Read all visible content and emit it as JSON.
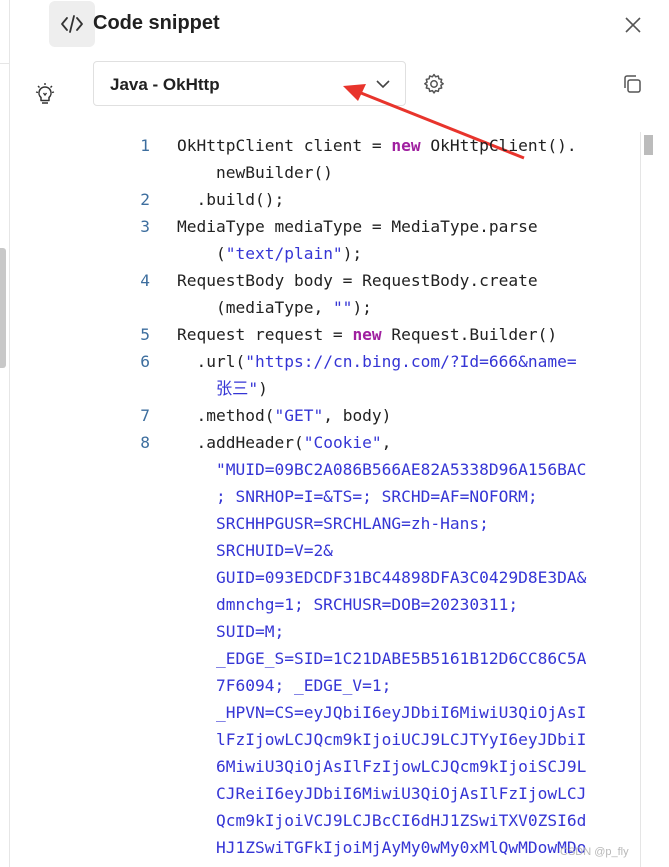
{
  "panel": {
    "title": "Code snippet"
  },
  "rail": {
    "items": [
      "code-icon",
      "lightbulb-icon"
    ]
  },
  "select": {
    "value": "Java - OkHttp"
  },
  "code": [
    {
      "n": "1",
      "parts": [
        [
          "t",
          "OkHttpClient client = "
        ],
        [
          "k",
          "new"
        ],
        [
          "t",
          " OkHttpClient()."
        ],
        [
          "br",
          ""
        ],
        [
          "t",
          "    newBuilder()"
        ]
      ]
    },
    {
      "n": "2",
      "parts": [
        [
          "t",
          "  .build();"
        ]
      ]
    },
    {
      "n": "3",
      "parts": [
        [
          "t",
          "MediaType mediaType = MediaType.parse"
        ],
        [
          "br",
          ""
        ],
        [
          "t",
          "    ("
        ],
        [
          "s",
          "\"text/plain\""
        ],
        [
          "t",
          ");"
        ]
      ]
    },
    {
      "n": "4",
      "parts": [
        [
          "t",
          "RequestBody body = RequestBody.create"
        ],
        [
          "br",
          ""
        ],
        [
          "t",
          "    (mediaType, "
        ],
        [
          "s",
          "\"\""
        ],
        [
          "t",
          ");"
        ]
      ]
    },
    {
      "n": "5",
      "parts": [
        [
          "t",
          "Request request = "
        ],
        [
          "k",
          "new"
        ],
        [
          "t",
          " Request.Builder()"
        ]
      ]
    },
    {
      "n": "6",
      "parts": [
        [
          "t",
          "  .url("
        ],
        [
          "s",
          "\"https://cn.bing.com/?Id=666&name="
        ],
        [
          "br",
          ""
        ],
        [
          "s",
          "    张三\""
        ],
        [
          "t",
          ")"
        ]
      ]
    },
    {
      "n": "7",
      "parts": [
        [
          "t",
          "  .method("
        ],
        [
          "s",
          "\"GET\""
        ],
        [
          "t",
          ", body)"
        ]
      ]
    },
    {
      "n": "8",
      "parts": [
        [
          "t",
          "  .addHeader("
        ],
        [
          "s",
          "\"Cookie\""
        ],
        [
          "t",
          ","
        ],
        [
          "br",
          ""
        ],
        [
          "s",
          "    \"MUID=09BC2A086B566AE82A5338D96A156BAC"
        ],
        [
          "br",
          ""
        ],
        [
          "s",
          "    ; SNRHOP=I=&TS=; SRCHD=AF=NOFORM;"
        ],
        [
          "br",
          ""
        ],
        [
          "s",
          "    SRCHHPGUSR=SRCHLANG=zh-Hans;"
        ],
        [
          "br",
          ""
        ],
        [
          "s",
          "    SRCHUID=V=2&"
        ],
        [
          "br",
          ""
        ],
        [
          "s",
          "    GUID=093EDCDF31BC44898DFA3C0429D8E3DA&"
        ],
        [
          "br",
          ""
        ],
        [
          "s",
          "    dmnchg=1; SRCHUSR=DOB=20230311;"
        ],
        [
          "br",
          ""
        ],
        [
          "s",
          "    SUID=M;"
        ],
        [
          "br",
          ""
        ],
        [
          "s",
          "    _EDGE_S=SID=1C21DABE5B5161B12D6CC86C5A"
        ],
        [
          "br",
          ""
        ],
        [
          "s",
          "    7F6094; _EDGE_V=1;"
        ],
        [
          "br",
          ""
        ],
        [
          "s",
          "    _HPVN=CS=eyJQbiI6eyJDbiI6MiwiU3QiOjAsI"
        ],
        [
          "br",
          ""
        ],
        [
          "s",
          "    lFzIjowLCJQcm9kIjoiUCJ9LCJTYyI6eyJDbiI"
        ],
        [
          "br",
          ""
        ],
        [
          "s",
          "    6MiwiU3QiOjAsIlFzIjowLCJQcm9kIjoiSCJ9L"
        ],
        [
          "br",
          ""
        ],
        [
          "s",
          "    CJReiI6eyJDbiI6MiwiU3QiOjAsIlFzIjowLCJ"
        ],
        [
          "br",
          ""
        ],
        [
          "s",
          "    Qcm9kIjoiVCJ9LCJBcCI6dHJ1ZSwiTXV0ZSI6d"
        ],
        [
          "br",
          ""
        ],
        [
          "s",
          "    HJ1ZSwiTGFkIjoiMjAyMy0wMy0xMlQwMDowMDo"
        ]
      ]
    }
  ],
  "watermark": "CSDN @p_fly"
}
